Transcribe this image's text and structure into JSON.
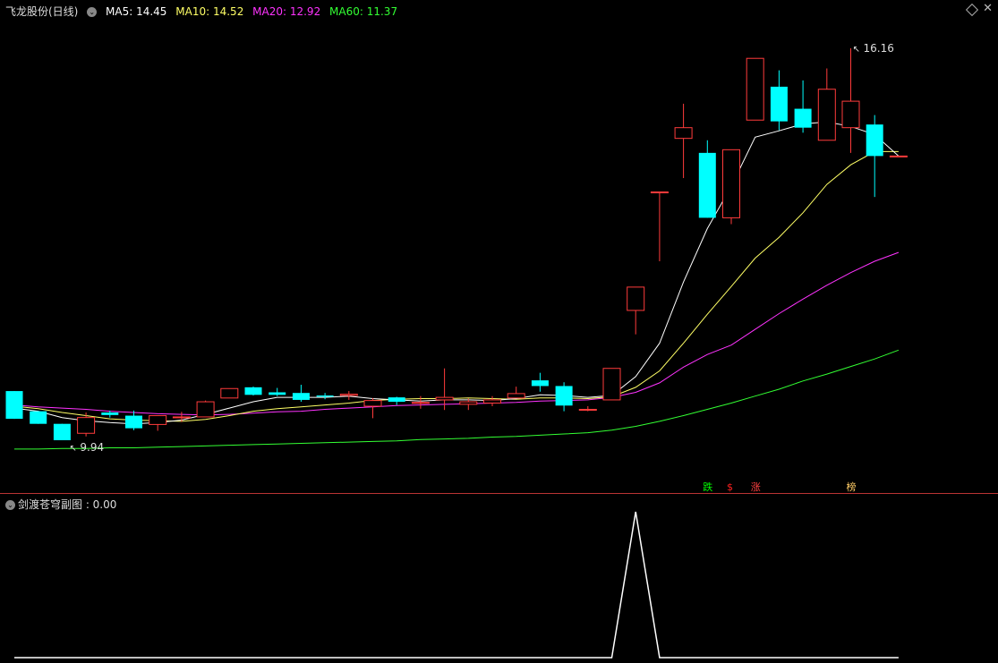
{
  "header": {
    "stock_name": "飞龙股份(日线)",
    "ma5": "MA5: 14.45",
    "ma10": "MA10: 14.52",
    "ma20": "MA20: 12.92",
    "ma60": "MA60: 11.37"
  },
  "sub_header": {
    "label": "剑渡苍穹副图 : 0.00"
  },
  "annotations": {
    "high_label": "16.16",
    "low_label": "9.94"
  },
  "markers": [
    {
      "text": "跌",
      "color": "#00ff00"
    },
    {
      "text": "$",
      "color": "#ff2020"
    },
    {
      "text": "涨",
      "color": "#ff4040"
    },
    {
      "text": "榜",
      "color": "#ffcc66"
    }
  ],
  "colors": {
    "up": "#ff3b3b",
    "down": "#00ffff",
    "ma5": "#ffffff",
    "ma10": "#ffff66",
    "ma20": "#ff33ff",
    "ma60": "#33ff33",
    "sub_line": "#ffffff"
  },
  "chart_data": {
    "type": "candlestick",
    "series": [
      {
        "open": 10.72,
        "high": 10.72,
        "low": 10.28,
        "close": 10.28
      },
      {
        "open": 10.4,
        "high": 10.4,
        "low": 10.2,
        "close": 10.2
      },
      {
        "open": 10.2,
        "high": 10.2,
        "low": 9.94,
        "close": 9.94
      },
      {
        "open": 10.05,
        "high": 10.38,
        "low": 10.0,
        "close": 10.3
      },
      {
        "open": 10.38,
        "high": 10.41,
        "low": 10.3,
        "close": 10.34
      },
      {
        "open": 10.33,
        "high": 10.41,
        "low": 10.1,
        "close": 10.13
      },
      {
        "open": 10.19,
        "high": 10.33,
        "low": 10.09,
        "close": 10.33
      },
      {
        "open": 10.31,
        "high": 10.39,
        "low": 10.23,
        "close": 10.31
      },
      {
        "open": 10.31,
        "high": 10.57,
        "low": 10.31,
        "close": 10.55
      },
      {
        "open": 10.61,
        "high": 10.76,
        "low": 10.61,
        "close": 10.76
      },
      {
        "open": 10.78,
        "high": 10.79,
        "low": 10.65,
        "close": 10.66
      },
      {
        "open": 10.7,
        "high": 10.77,
        "low": 10.64,
        "close": 10.66
      },
      {
        "open": 10.69,
        "high": 10.82,
        "low": 10.55,
        "close": 10.58
      },
      {
        "open": 10.65,
        "high": 10.69,
        "low": 10.59,
        "close": 10.63
      },
      {
        "open": 10.65,
        "high": 10.72,
        "low": 10.58,
        "close": 10.67
      },
      {
        "open": 10.48,
        "high": 10.61,
        "low": 10.29,
        "close": 10.57
      },
      {
        "open": 10.62,
        "high": 10.63,
        "low": 10.5,
        "close": 10.55
      },
      {
        "open": 10.54,
        "high": 10.64,
        "low": 10.44,
        "close": 10.54
      },
      {
        "open": 10.58,
        "high": 11.08,
        "low": 10.42,
        "close": 10.62
      },
      {
        "open": 10.51,
        "high": 10.6,
        "low": 10.42,
        "close": 10.55
      },
      {
        "open": 10.53,
        "high": 10.64,
        "low": 10.48,
        "close": 10.58
      },
      {
        "open": 10.61,
        "high": 10.79,
        "low": 10.61,
        "close": 10.68
      },
      {
        "open": 10.89,
        "high": 11.01,
        "low": 10.71,
        "close": 10.8
      },
      {
        "open": 10.8,
        "high": 10.86,
        "low": 10.4,
        "close": 10.49
      },
      {
        "open": 10.43,
        "high": 10.48,
        "low": 10.4,
        "close": 10.43
      },
      {
        "open": 10.58,
        "high": 11.08,
        "low": 10.58,
        "close": 11.08
      },
      {
        "open": 12.0,
        "high": 12.19,
        "low": 11.62,
        "close": 12.37
      },
      {
        "open": 13.88,
        "high": 13.88,
        "low": 12.78,
        "close": 13.88
      },
      {
        "open": 14.73,
        "high": 15.28,
        "low": 14.1,
        "close": 14.9
      },
      {
        "open": 14.5,
        "high": 14.7,
        "low": 13.47,
        "close": 13.47
      },
      {
        "open": 13.47,
        "high": 14.45,
        "low": 13.37,
        "close": 14.55
      },
      {
        "open": 15.02,
        "high": 15.02,
        "low": 15.02,
        "close": 16.0
      },
      {
        "open": 15.55,
        "high": 15.81,
        "low": 14.86,
        "close": 15.0
      },
      {
        "open": 15.2,
        "high": 15.65,
        "low": 14.82,
        "close": 14.9
      },
      {
        "open": 14.7,
        "high": 15.84,
        "low": 14.7,
        "close": 15.51
      },
      {
        "open": 14.9,
        "high": 16.16,
        "low": 14.5,
        "close": 15.32
      },
      {
        "open": 14.95,
        "high": 15.1,
        "low": 13.8,
        "close": 14.45
      },
      {
        "open": 14.45,
        "high": 14.45,
        "low": 14.45,
        "close": 14.45
      }
    ],
    "ma5": [
      10.45,
      10.4,
      10.3,
      10.25,
      10.22,
      10.2,
      10.22,
      10.26,
      10.35,
      10.45,
      10.55,
      10.62,
      10.62,
      10.62,
      10.64,
      10.6,
      10.58,
      10.56,
      10.58,
      10.58,
      10.57,
      10.6,
      10.66,
      10.65,
      10.62,
      10.65,
      10.95,
      11.48,
      12.45,
      13.3,
      13.97,
      14.75,
      14.85,
      14.96,
      14.99,
      14.92,
      14.79,
      14.45
    ],
    "ma10": [
      10.48,
      10.44,
      10.38,
      10.33,
      10.28,
      10.26,
      10.25,
      10.24,
      10.27,
      10.33,
      10.4,
      10.44,
      10.47,
      10.5,
      10.53,
      10.57,
      10.59,
      10.6,
      10.6,
      10.61,
      10.6,
      10.59,
      10.61,
      10.61,
      10.6,
      10.63,
      10.78,
      11.04,
      11.48,
      11.94,
      12.38,
      12.83,
      13.16,
      13.55,
      14.0,
      14.31,
      14.52,
      14.52
    ],
    "ma20": [
      10.5,
      10.47,
      10.45,
      10.43,
      10.4,
      10.38,
      10.36,
      10.35,
      10.34,
      10.35,
      10.37,
      10.39,
      10.4,
      10.43,
      10.45,
      10.47,
      10.49,
      10.5,
      10.51,
      10.52,
      10.53,
      10.54,
      10.56,
      10.57,
      10.58,
      10.62,
      10.7,
      10.85,
      11.1,
      11.3,
      11.45,
      11.7,
      11.95,
      12.18,
      12.4,
      12.6,
      12.78,
      12.92
    ],
    "ma60": [
      9.8,
      9.8,
      9.81,
      9.81,
      9.82,
      9.82,
      9.83,
      9.84,
      9.85,
      9.86,
      9.87,
      9.88,
      9.89,
      9.9,
      9.91,
      9.92,
      9.93,
      9.95,
      9.96,
      9.97,
      9.99,
      10.0,
      10.02,
      10.04,
      10.06,
      10.1,
      10.16,
      10.24,
      10.33,
      10.43,
      10.53,
      10.64,
      10.75,
      10.88,
      10.99,
      11.11,
      11.23,
      11.37
    ],
    "sub_indicator": [
      0,
      0,
      0,
      0,
      0,
      0,
      0,
      0,
      0,
      0,
      0,
      0,
      0,
      0,
      0,
      0,
      0,
      0,
      0,
      0,
      0,
      0,
      0,
      0,
      0,
      0,
      1,
      0,
      0,
      0,
      0,
      0,
      0,
      0,
      0,
      0,
      0,
      0
    ]
  }
}
